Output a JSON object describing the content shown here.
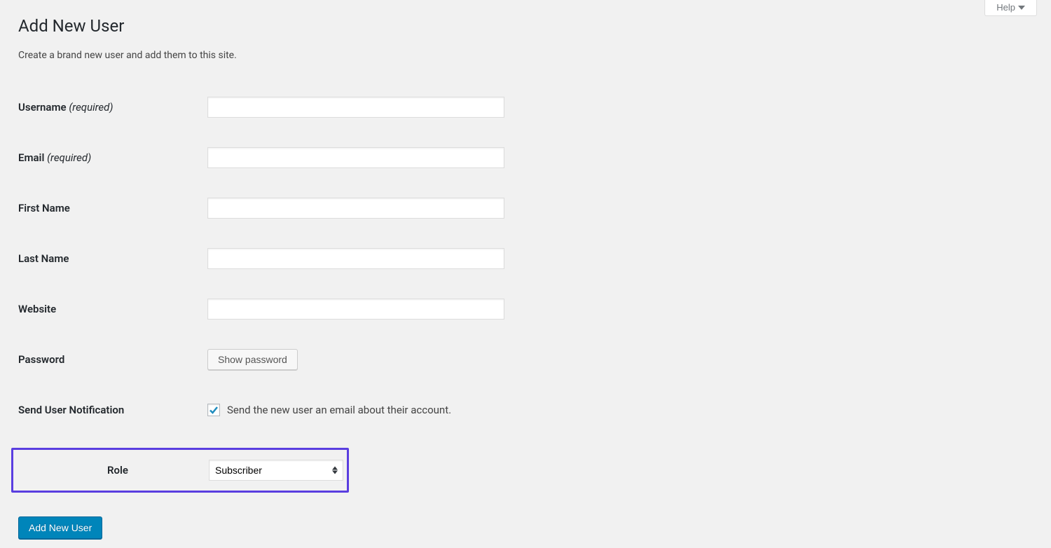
{
  "screenMeta": {
    "help_label": "Help"
  },
  "header": {
    "title": "Add New User",
    "subtitle": "Create a brand new user and add them to this site."
  },
  "form": {
    "username": {
      "label": "Username",
      "required": "(required)",
      "value": ""
    },
    "email": {
      "label": "Email",
      "required": "(required)",
      "value": ""
    },
    "first_name": {
      "label": "First Name",
      "value": ""
    },
    "last_name": {
      "label": "Last Name",
      "value": ""
    },
    "website": {
      "label": "Website",
      "value": ""
    },
    "password": {
      "label": "Password",
      "show_button": "Show password"
    },
    "notification": {
      "label": "Send User Notification",
      "checkbox_label": "Send the new user an email about their account.",
      "checked": true
    },
    "role": {
      "label": "Role",
      "selected": "Subscriber"
    }
  },
  "submit": {
    "button_label": "Add New User"
  }
}
